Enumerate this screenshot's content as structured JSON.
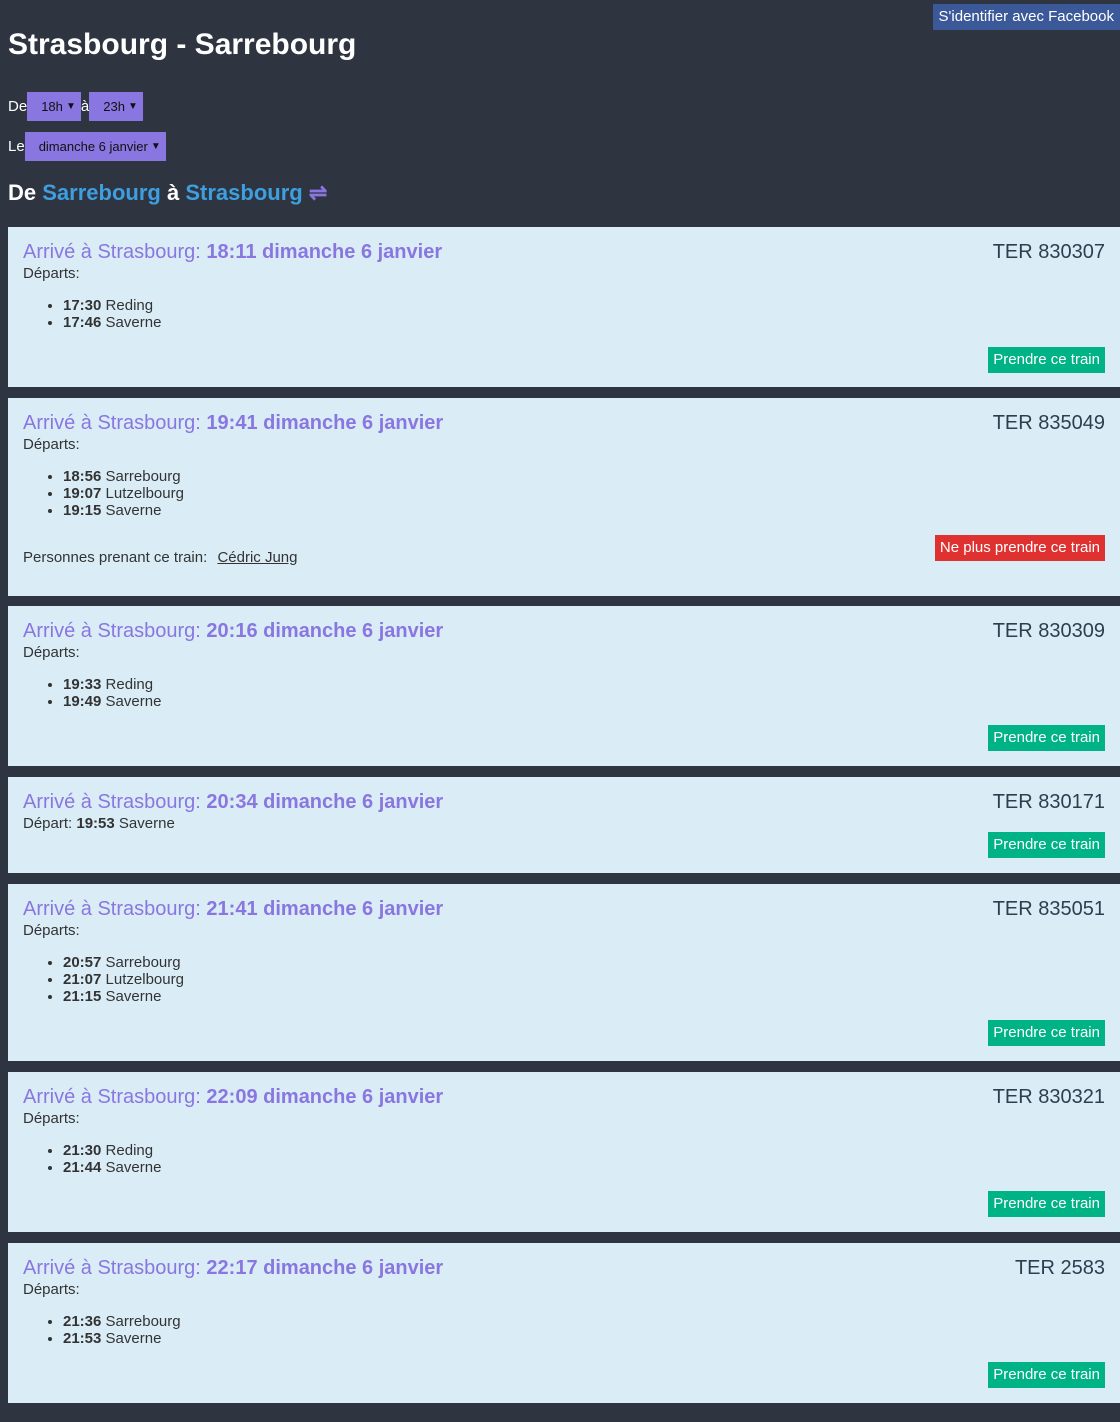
{
  "header": {
    "facebook_button": "S'identifier avec Facebook",
    "title": "Strasbourg - Sarrebourg"
  },
  "filters": {
    "from_label": "De",
    "from_value": "18h",
    "to_label": "à",
    "to_value": "23h",
    "date_label": "Le",
    "date_value": "dimanche 6 janvier"
  },
  "route": {
    "de": "De",
    "origin": "Sarrebourg",
    "a": "à",
    "destination": "Strasbourg",
    "swap_icon": "⇌"
  },
  "trains": [
    {
      "arrival_prefix": "Arrivé à Strasbourg:",
      "arrival_time": "18:11 dimanche 6 janvier",
      "ter": "TER 830307",
      "departures_label": "Départs:",
      "departures": [
        {
          "time": "17:30",
          "station": "Reding"
        },
        {
          "time": "17:46",
          "station": "Saverne"
        }
      ],
      "button": "Prendre ce train"
    },
    {
      "arrival_prefix": "Arrivé à Strasbourg:",
      "arrival_time": "19:41 dimanche 6 janvier",
      "ter": "TER 835049",
      "departures_label": "Départs:",
      "departures": [
        {
          "time": "18:56",
          "station": "Sarrebourg"
        },
        {
          "time": "19:07",
          "station": "Lutzelbourg"
        },
        {
          "time": "19:15",
          "station": "Saverne"
        }
      ],
      "persons_label": "Personnes prenant ce train:",
      "person": "Cédric Jung",
      "button": "Ne plus prendre ce train"
    },
    {
      "arrival_prefix": "Arrivé à Strasbourg:",
      "arrival_time": "20:16 dimanche 6 janvier",
      "ter": "TER 830309",
      "departures_label": "Départs:",
      "departures": [
        {
          "time": "19:33",
          "station": "Reding"
        },
        {
          "time": "19:49",
          "station": "Saverne"
        }
      ],
      "button": "Prendre ce train"
    },
    {
      "arrival_prefix": "Arrivé à Strasbourg:",
      "arrival_time": "20:34 dimanche 6 janvier",
      "ter": "TER 830171",
      "departure_label": "Départ:",
      "departure_time": "19:53",
      "departure_station": "Saverne",
      "button": "Prendre ce train"
    },
    {
      "arrival_prefix": "Arrivé à Strasbourg:",
      "arrival_time": "21:41 dimanche 6 janvier",
      "ter": "TER 835051",
      "departures_label": "Départs:",
      "departures": [
        {
          "time": "20:57",
          "station": "Sarrebourg"
        },
        {
          "time": "21:07",
          "station": "Lutzelbourg"
        },
        {
          "time": "21:15",
          "station": "Saverne"
        }
      ],
      "button": "Prendre ce train"
    },
    {
      "arrival_prefix": "Arrivé à Strasbourg:",
      "arrival_time": "22:09 dimanche 6 janvier",
      "ter": "TER 830321",
      "departures_label": "Départs:",
      "departures": [
        {
          "time": "21:30",
          "station": "Reding"
        },
        {
          "time": "21:44",
          "station": "Saverne"
        }
      ],
      "button": "Prendre ce train"
    },
    {
      "arrival_prefix": "Arrivé à Strasbourg:",
      "arrival_time": "22:17 dimanche 6 janvier",
      "ter": "TER 2583",
      "departures_label": "Départs:",
      "departures": [
        {
          "time": "21:36",
          "station": "Sarrebourg"
        },
        {
          "time": "21:53",
          "station": "Saverne"
        }
      ],
      "button": "Prendre ce train"
    }
  ]
}
